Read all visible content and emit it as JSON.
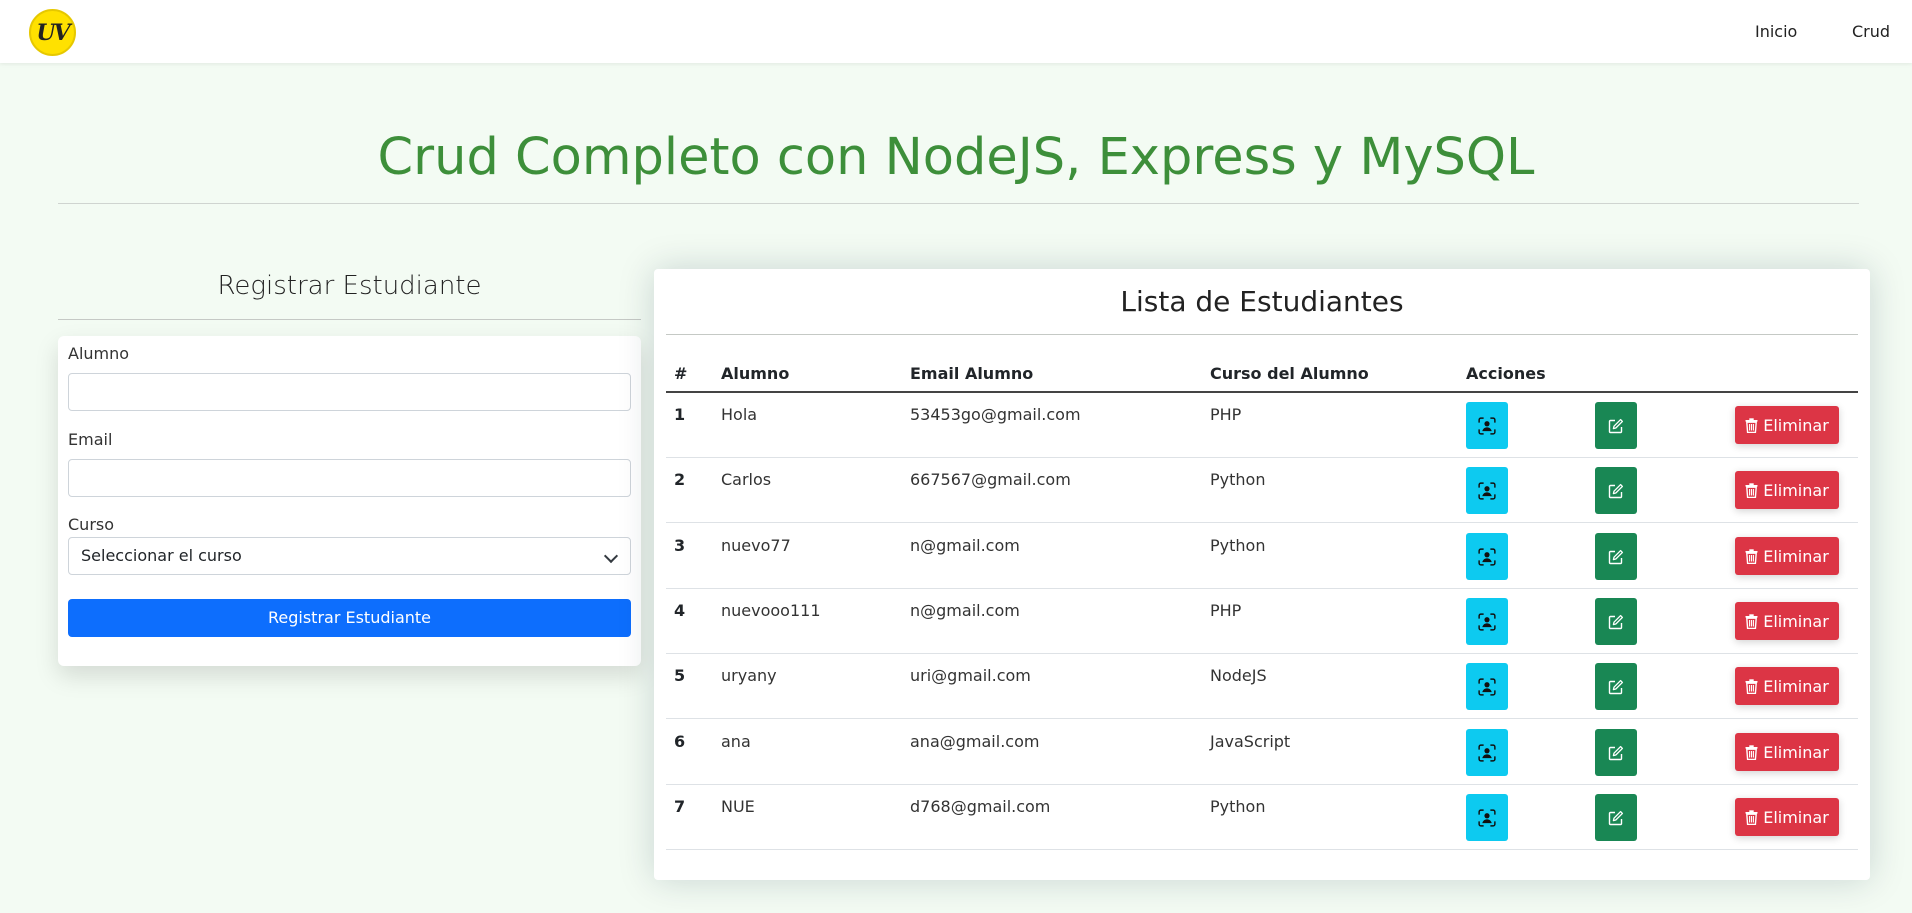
{
  "navbar": {
    "logo_text": "UV",
    "links": [
      "Inicio",
      "Crud"
    ]
  },
  "page": {
    "title": "Crud Completo con NodeJS, Express y MySQL"
  },
  "form": {
    "heading": "Registrar Estudiante",
    "alumno_label": "Alumno",
    "alumno_value": "",
    "email_label": "Email",
    "email_value": "",
    "curso_label": "Curso",
    "curso_selected": "Seleccionar el curso",
    "submit_label": "Registrar Estudiante"
  },
  "table": {
    "heading": "Lista de Estudiantes",
    "columns": [
      "#",
      "Alumno",
      "Email Alumno",
      "Curso del Alumno",
      "Acciones"
    ],
    "delete_label": "Eliminar",
    "rows": [
      {
        "num": "1",
        "alumno": "Hola",
        "email": "53453go@gmail.com",
        "curso": "PHP"
      },
      {
        "num": "2",
        "alumno": "Carlos",
        "email": "667567@gmail.com",
        "curso": "Python"
      },
      {
        "num": "3",
        "alumno": "nuevo77",
        "email": "n@gmail.com",
        "curso": "Python"
      },
      {
        "num": "4",
        "alumno": "nuevooo111",
        "email": "n@gmail.com",
        "curso": "PHP"
      },
      {
        "num": "5",
        "alumno": "uryany",
        "email": "uri@gmail.com",
        "curso": "NodeJS"
      },
      {
        "num": "6",
        "alumno": "ana",
        "email": "ana@gmail.com",
        "curso": "JavaScript"
      },
      {
        "num": "7",
        "alumno": "NUE",
        "email": "d768@gmail.com",
        "curso": "Python"
      }
    ]
  },
  "icons": {
    "view": "person-bounding-box-icon",
    "edit": "edit-square-icon",
    "delete": "trash-icon"
  },
  "colors": {
    "title_green": "#3d8f3a",
    "primary": "#0d6efd",
    "info": "#0dcaf0",
    "success": "#198754",
    "danger": "#dc3545"
  }
}
